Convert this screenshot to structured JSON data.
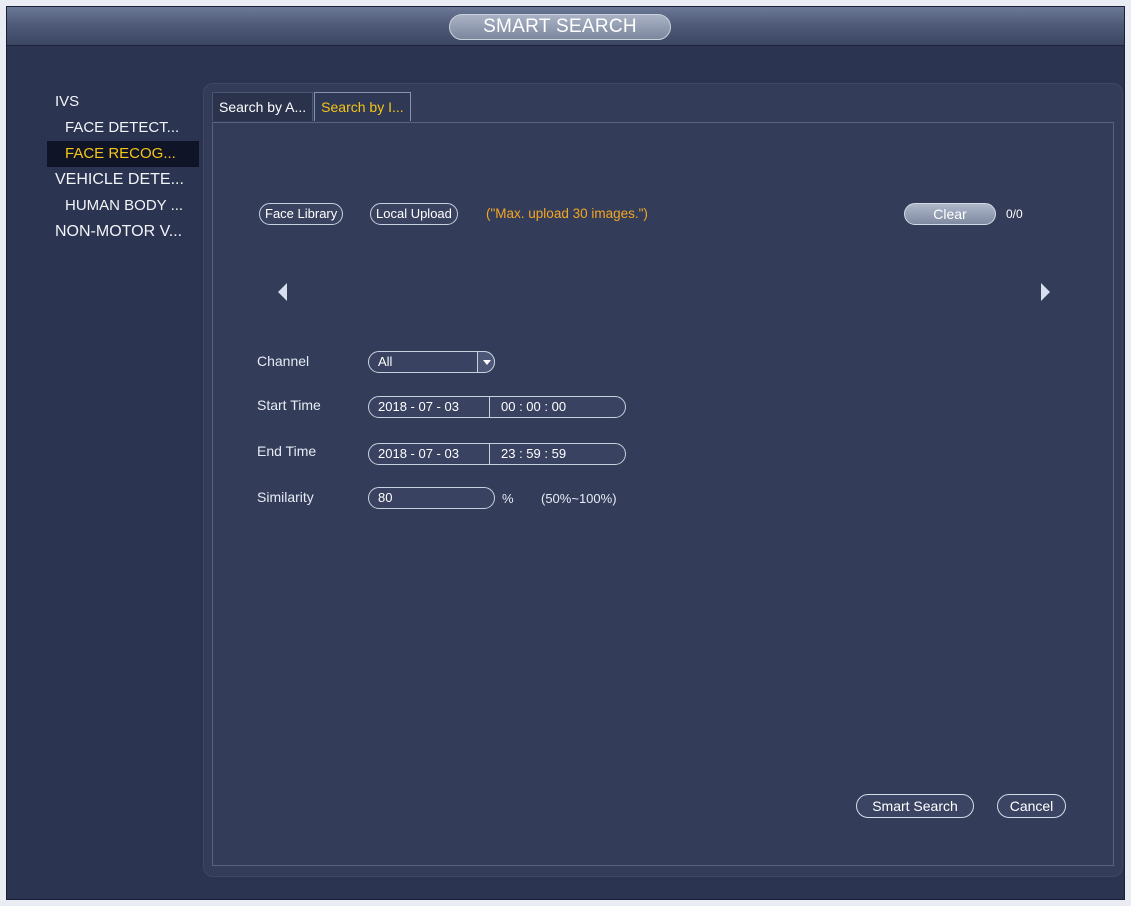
{
  "window": {
    "title": "SMART SEARCH"
  },
  "sidebar": {
    "items": [
      {
        "label": "IVS"
      },
      {
        "label": "FACE DETECT..."
      },
      {
        "label": "FACE RECOG..."
      },
      {
        "label": "VEHICLE DETE..."
      },
      {
        "label": "HUMAN BODY ..."
      },
      {
        "label": "NON-MOTOR V..."
      }
    ],
    "active_index": 2
  },
  "tabs": [
    {
      "label": "Search by A..."
    },
    {
      "label": "Search by I..."
    }
  ],
  "upload": {
    "face_library_label": "Face Library",
    "local_upload_label": "Local Upload",
    "note": "(\"Max. upload 30 images.\")",
    "clear_label": "Clear",
    "count": "0/0"
  },
  "form": {
    "channel_label": "Channel",
    "channel_value": "All",
    "start_time_label": "Start Time",
    "start_date": "2018  - 07 - 03",
    "start_time": "00 : 00 : 00",
    "end_time_label": "End Time",
    "end_date": "2018  - 07 - 03",
    "end_time": "23 : 59 : 59",
    "similarity_label": "Similarity",
    "similarity_value": "80",
    "similarity_unit": "%",
    "similarity_range": "(50%~100%)"
  },
  "actions": {
    "smart_search_label": "Smart Search",
    "cancel_label": "Cancel"
  },
  "colors": {
    "background": "#2b3450",
    "active_text": "#f5c518",
    "note_text": "#f5a623"
  }
}
